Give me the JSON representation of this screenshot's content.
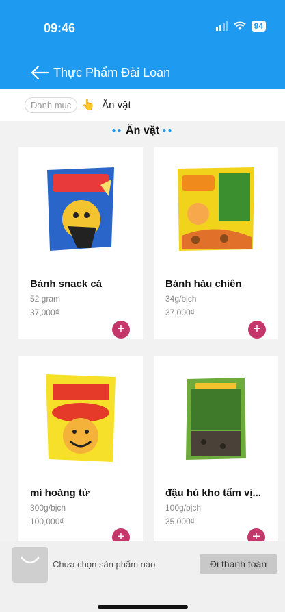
{
  "status": {
    "time": "09:46",
    "battery": "94"
  },
  "header": {
    "title": "Thực Phẩm Đài Loan"
  },
  "breadcrumb": {
    "category_label": "Danh mục",
    "current": "Ăn vặt"
  },
  "section": {
    "title": "Ăn vặt"
  },
  "products": [
    {
      "name": "Bánh snack cá",
      "weight": "52 gram",
      "price": "37,000₫"
    },
    {
      "name": "Bánh hàu chiên",
      "weight": "34g/bịch",
      "price": "37,000₫"
    },
    {
      "name": "mì hoàng tử",
      "weight": "300g/bịch",
      "price": "100,000₫"
    },
    {
      "name": "đậu hủ kho tẩm vị...",
      "weight": "100g/bịch",
      "price": "35,000₫"
    }
  ],
  "cart": {
    "empty_text": "Chưa chọn sản phẩm nào",
    "checkout_label": "Đi thanh toán"
  },
  "colors": {
    "header": "#1e9bf0",
    "add_button": "#c4376a"
  }
}
